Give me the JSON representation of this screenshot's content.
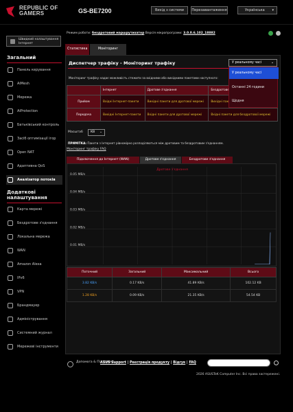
{
  "header": {
    "brand_line1": "REPUBLIC OF",
    "brand_line2": "GAMERS",
    "model": "GS-BE7200",
    "logout": "Вихід з системи",
    "reboot": "Перезавантаження",
    "language": "Українська"
  },
  "status": {
    "mode_label": "Режим роботи:",
    "mode_value": "бездротовий маршрутизатор",
    "fw_label": "Версія мікропрограми:",
    "fw_value": "3.0.0.6.102_18882"
  },
  "sidebar": {
    "quick": "Швидкий налаштування Інтернет",
    "general_title": "Загальний",
    "general": [
      "Панель керування",
      "AiMesh",
      "Мережа",
      "AiProtection",
      "Батьківський контроль",
      "Засіб оптимізації ігор",
      "Open NAT",
      "Адаптивна QoS",
      "Аналізатор потоків"
    ],
    "advanced_title": "Додаткові налаштування",
    "advanced": [
      "Карта мережі",
      "Бездротове з'єднання",
      "Локальна мережа",
      "WAN",
      "Amazon Alexa",
      "IPv6",
      "VPN",
      "Брандмауер",
      "Адміністрування",
      "Системний журнал",
      "Мережеві інструменти"
    ]
  },
  "tabs": [
    "Статистика",
    "Моніторинг трафіку"
  ],
  "page": {
    "title": "Диспетчер трафіку - Моніторинг трафіку",
    "description": "Моніторинг трафіку надає можливість стежити за вхідними або вихідними пакетами наступного:"
  },
  "dropdown": {
    "selected": "У реальному часі",
    "options": [
      "У реальному часі",
      "Останні 24 години",
      "Щодня"
    ]
  },
  "traffic_table": {
    "headers": [
      "",
      "Інтернет",
      "Дротове з'єднання",
      "Бездротове з'єднання"
    ],
    "rows": [
      {
        "label": "Прийом",
        "cells": [
          "Вхідні Інтернет-пакети",
          "Вихідні пакети для дротової мережі",
          "Вихідні пакети для бездротової мережі"
        ]
      },
      {
        "label": "Передача",
        "cells": [
          "Вихідні Інтернет-пакети",
          "Вхідні пакети для дротової мережі",
          "Вхідні пакети для бездротової мережі"
        ]
      }
    ]
  },
  "scale": {
    "label": "Масштаб",
    "value": "KB"
  },
  "note": {
    "prefix": "ПРИМІТКА:",
    "text": "Пакети з Інтернет рівномірно розподіляються між дротовим та бездротовим з'єднанням."
  },
  "faq": "Моніторинг трафіку FAQ",
  "chart_tabs": [
    "Підключення до Інтернет (WAN)",
    "Дротове з'єднання",
    "Бездротове з'єднання"
  ],
  "chart_data": {
    "type": "line",
    "title": "Дротове з'єднання",
    "yticks": [
      "0.05 MB/s",
      "0.04 MB/s",
      "0.03 MB/s",
      "0.02 MB/s",
      "0.01 MB/s"
    ],
    "ylim": [
      0,
      0.055
    ],
    "series": [
      {
        "name": "",
        "values": [
          0.0001,
          0.0001,
          0.0001,
          0.0001,
          0.0001,
          0.0001,
          0.0001,
          0.0001,
          0.0001,
          0.0001,
          0.0001,
          0.0001,
          0.0001,
          0.0001,
          0.0001,
          0.0001,
          0.0001,
          0.0001,
          0.0001,
          0.018
        ]
      }
    ]
  },
  "stats": {
    "headers": [
      "Поточний",
      "Загальний",
      "Максимальний",
      "Всього"
    ],
    "rows": [
      [
        "3.82 KB/s",
        "0.17 KB/s",
        "41.89 KB/s",
        "102.12 KB"
      ],
      [
        "1.28 KB/s",
        "0.09 KB/s",
        "21.35 KB/s",
        "54.54 KB"
      ]
    ],
    "row_colors": [
      "#4aa3ff",
      "#f0a020"
    ]
  },
  "footer": {
    "help": "Допомога & Підтримка",
    "links": [
      "ASUS Support",
      "Реєстрація продукту",
      "Відгук",
      "FAQ"
    ],
    "copyright": "2026 ASUSTeK Computer Inc. Всі права застережені."
  },
  "colors": {
    "accent": "#c8102e",
    "tab": "#5e0b16"
  }
}
